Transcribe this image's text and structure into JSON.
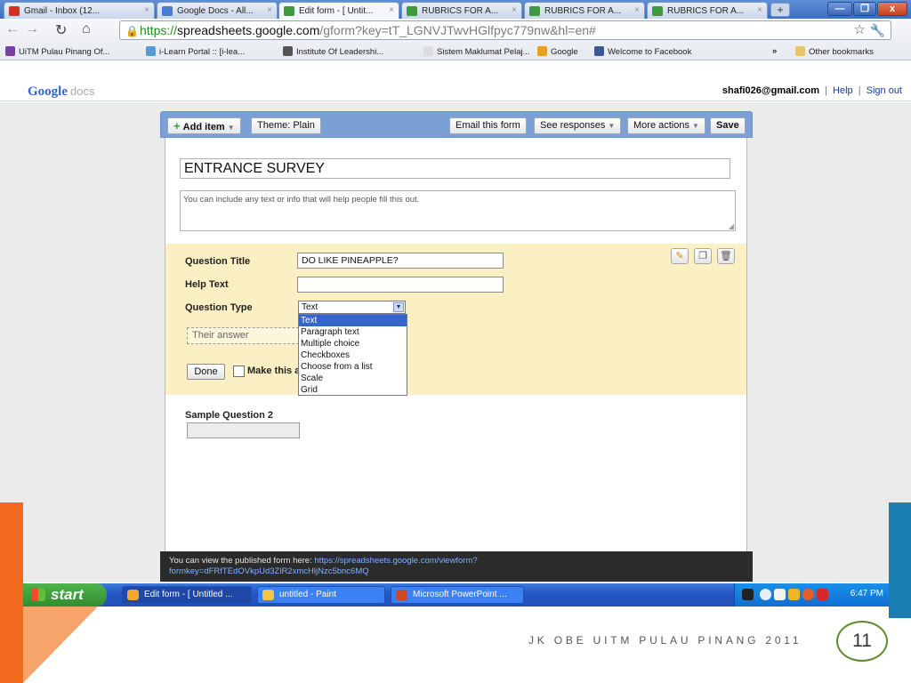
{
  "colors": {
    "tabbar": "#3d6fbf",
    "editor_toolbar": "#7aa0d6",
    "question_highlight": "#fbf0c4",
    "selected_option": "#3366cc",
    "taskbar": "#2457c4",
    "start_button": "#318c2e",
    "slide_orange": "#f26a1f",
    "slide_blue": "#1c7fb3",
    "page_circle": "#5b8c2a"
  },
  "browser": {
    "tabs": [
      {
        "label": "Gmail - Inbox (12...",
        "icon": "gmail-icon",
        "color": "#d93025"
      },
      {
        "label": "Google Docs - All...",
        "icon": "docs-icon",
        "color": "#4a7bd4"
      },
      {
        "label": "Edit form - [ Untit...",
        "icon": "form-icon",
        "color": "#3f9a3f"
      },
      {
        "label": "RUBRICS FOR A...",
        "icon": "spreadsheet-icon",
        "color": "#3f9a3f"
      },
      {
        "label": "RUBRICS FOR A...",
        "icon": "spreadsheet-icon",
        "color": "#3f9a3f"
      },
      {
        "label": "RUBRICS FOR A...",
        "icon": "spreadsheet-icon",
        "color": "#3f9a3f"
      }
    ],
    "new_tab": "+",
    "window_buttons": {
      "minimize": "—",
      "maximize": "❐",
      "close": "x"
    },
    "url": {
      "scheme": "https://",
      "host": "spreadsheets.google.com",
      "path": "/gform?key=tT_LGNVJTwvHGlfpyc779nw&hl=en#"
    },
    "bookmarks": [
      {
        "label": "UiTM Pulau Pinang Of...",
        "color": "#7a3fa0"
      },
      {
        "label": "i-Learn Portal :: [i-lea...",
        "color": "#5b9bd5"
      },
      {
        "label": "Institute Of Leadershi...",
        "color": "#555555"
      },
      {
        "label": "Sistem Maklumat Pelaj...",
        "color": "#dddddd"
      },
      {
        "label": "Google",
        "color": "#e8a020"
      },
      {
        "label": "Welcome to Facebook",
        "color": "#3b5998"
      }
    ],
    "bookmarks_more": "»",
    "other_bookmarks": "Other bookmarks"
  },
  "docs_bar": {
    "logo": "Google",
    "logo_suffix": "docs",
    "email": "shafi026@gmail.com",
    "separator": "|",
    "help": "Help",
    "sign_out": "Sign out"
  },
  "form_toolbar": {
    "add_item": "Add item",
    "theme": "Theme: Plain",
    "email_form": "Email this form",
    "see_responses": "See responses",
    "more_actions": "More actions",
    "save": "Save"
  },
  "form": {
    "title": "ENTRANCE SURVEY",
    "description_placeholder": "You can include any text or info that will help people fill this out."
  },
  "question_editor": {
    "title_label": "Question Title",
    "title_value": "DO LIKE PINEAPPLE?",
    "help_label": "Help Text",
    "help_value": "",
    "type_label": "Question Type",
    "type_selected": "Text",
    "type_options": [
      "Text",
      "Paragraph text",
      "Multiple choice",
      "Checkboxes",
      "Choose from a list",
      "Scale",
      "Grid"
    ],
    "answer_placeholder": "Their answer",
    "done": "Done",
    "required_label": "Make this a required question"
  },
  "sample_question": {
    "title": "Sample Question 2"
  },
  "publish": {
    "text": "You can view the published form here: ",
    "url_line1": "https://spreadsheets.google.com/viewform?",
    "url_line2": "formkey=dFRfTEdOVkpUd3ZlR2xmcHljNzc5bnc6MQ"
  },
  "taskbar": {
    "start": "start",
    "tasks": [
      {
        "label": "Edit form - [ Untitled ...",
        "color": "#f2a62a"
      },
      {
        "label": "untitled - Paint",
        "color": "#f5c542"
      },
      {
        "label": "Microsoft PowerPoint ...",
        "color": "#d24726"
      }
    ],
    "clock": "6:47 PM"
  },
  "slide": {
    "footer": "JK OBE UITM PULAU PINANG 2011",
    "page_number": "11"
  }
}
